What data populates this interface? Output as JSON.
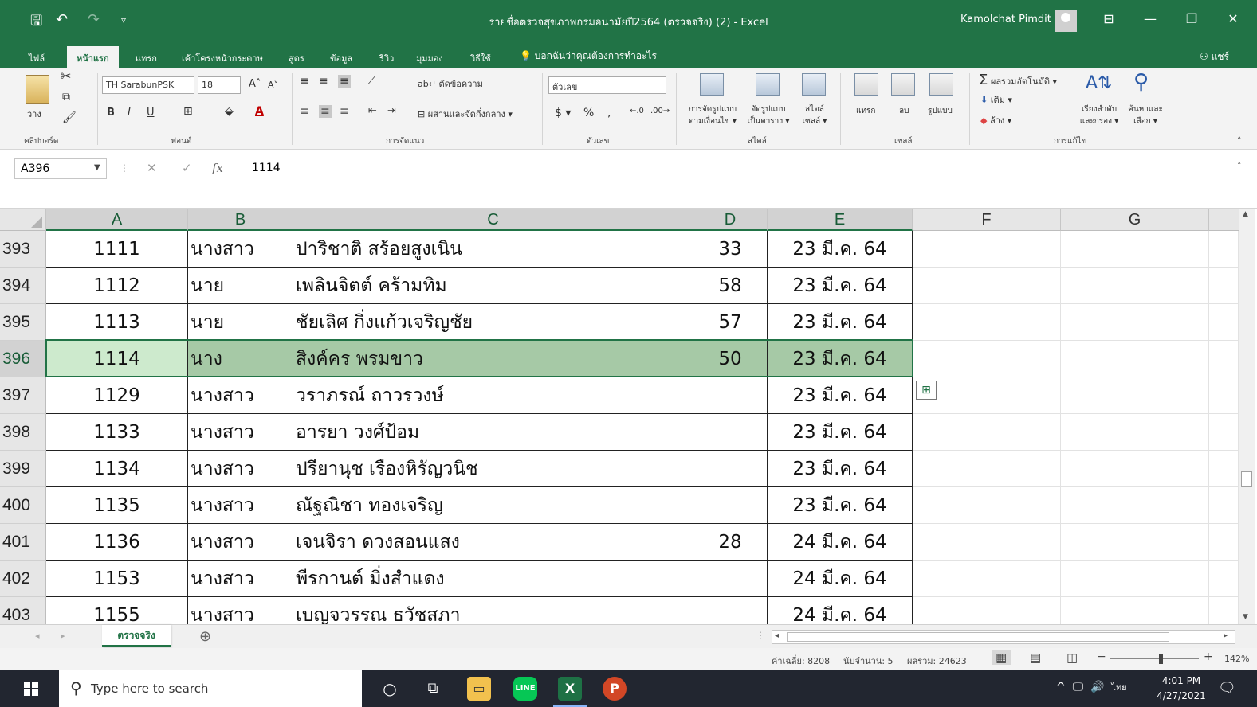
{
  "window": {
    "title": "รายชื่อตรวจสุขภาพกรมอนามัยปี2564 (ตรวจจริง) (2)  -  Excel",
    "user": "Kamolchat Pimdit"
  },
  "ribbon_tabs": [
    "ไฟล์",
    "หน้าแรก",
    "แทรก",
    "เค้าโครงหน้ากระดาษ",
    "สูตร",
    "ข้อมูล",
    "รีวิว",
    "มุมมอง",
    "วิธีใช้"
  ],
  "tell_me": "บอกฉันว่าคุณต้องการทำอะไร",
  "share": "แชร์",
  "ribbon": {
    "clipboard": {
      "label": "คลิปบอร์ด",
      "paste": "วาง"
    },
    "font": {
      "label": "ฟอนต์",
      "name": "TH SarabunPSK",
      "size": "18"
    },
    "alignment": {
      "label": "การจัดแนว",
      "wrap": "ตัดข้อความ",
      "merge": "ผสานและจัดกึ่งกลาง"
    },
    "number": {
      "label": "ตัวเลข",
      "format": "ตัวเลข"
    },
    "styles": {
      "label": "สไตล์",
      "cond1": "การจัดรูปแบบ",
      "cond2": "ตามเงื่อนไข",
      "table1": "จัดรูปแบบ",
      "table2": "เป็นตาราง",
      "cell1": "สไตล์",
      "cell2": "เซลล์"
    },
    "cells": {
      "label": "เซลล์",
      "insert": "แทรก",
      "delete": "ลบ",
      "format": "รูปแบบ"
    },
    "editing": {
      "label": "การแก้ไข",
      "autosum": "ผลรวมอัตโนมัติ",
      "fill": "เติม",
      "clear": "ล้าง",
      "sort1": "เรียงลำดับ",
      "sort2": "และกรอง",
      "find1": "ค้นหาและ",
      "find2": "เลือก"
    }
  },
  "formula_bar": {
    "name_box": "A396",
    "value": "1114"
  },
  "columns": [
    "A",
    "B",
    "C",
    "D",
    "E",
    "F",
    "G"
  ],
  "rows": [
    {
      "num": "393",
      "a": "1111",
      "b": "นางสาว",
      "c": "ปาริชาติ สร้อยสูงเนิน",
      "d": "33",
      "e": "23 มี.ค. 64"
    },
    {
      "num": "394",
      "a": "1112",
      "b": "นาย",
      "c": "เพลินจิตต์  คร้ามทิม",
      "d": "58",
      "e": "23 มี.ค. 64"
    },
    {
      "num": "395",
      "a": "1113",
      "b": "นาย",
      "c": "ชัยเลิศ  กิ่งแก้วเจริญชัย",
      "d": "57",
      "e": "23 มี.ค. 64"
    },
    {
      "num": "396",
      "a": "1114",
      "b": "นาง",
      "c": "สิงค์คร   พรมขาว",
      "d": "50",
      "e": "23 มี.ค. 64"
    },
    {
      "num": "397",
      "a": "1129",
      "b": "นางสาว",
      "c": "วราภรณ์ ถาวรวงษ์",
      "d": "",
      "e": "23 มี.ค. 64"
    },
    {
      "num": "398",
      "a": "1133",
      "b": "นางสาว",
      "c": "อารยา วงศ์ป้อม",
      "d": "",
      "e": "23 มี.ค. 64"
    },
    {
      "num": "399",
      "a": "1134",
      "b": "นางสาว",
      "c": "ปรียานุช เรืองหิรัญวนิช",
      "d": "",
      "e": "23 มี.ค. 64"
    },
    {
      "num": "400",
      "a": "1135",
      "b": "นางสาว",
      "c": "ณัฐณิชา ทองเจริญ",
      "d": "",
      "e": "23 มี.ค. 64"
    },
    {
      "num": "401",
      "a": "1136",
      "b": "นางสาว",
      "c": "เจนจิรา ดวงสอนแสง",
      "d": "28",
      "e": "24 มี.ค. 64"
    },
    {
      "num": "402",
      "a": "1153",
      "b": "นางสาว",
      "c": "พีรกานต์ มิ่งสำแดง",
      "d": "",
      "e": "24 มี.ค. 64"
    },
    {
      "num": "403",
      "a": "1155",
      "b": "นางสาว",
      "c": "เบญจวรรณ ธวัชสภา",
      "d": "",
      "e": "24 มี.ค. 64"
    }
  ],
  "selected_row": "396",
  "sheet_tab": "ตรวจจริง",
  "status": {
    "average": "ค่าเฉลี่ย: 8208",
    "count": "นับจำนวน: 5",
    "sum": "ผลรวม: 24623",
    "zoom": "142%"
  },
  "taskbar": {
    "search_placeholder": "Type here to search",
    "lang": "ไทย",
    "time": "4:01 PM",
    "date": "4/27/2021"
  }
}
